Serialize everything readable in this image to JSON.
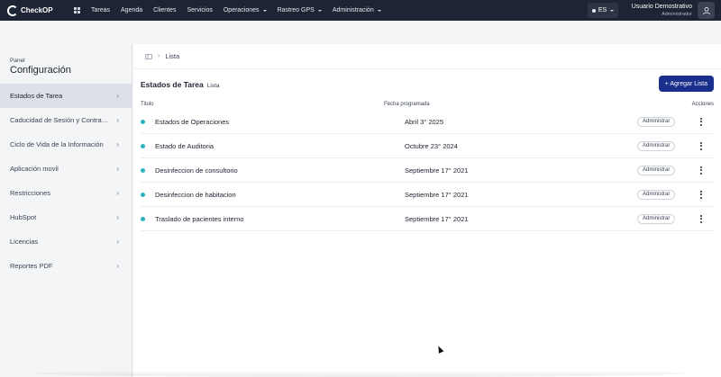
{
  "topbar": {
    "brand": "CheckOP",
    "nav": [
      {
        "label": "Tareas",
        "caret": false
      },
      {
        "label": "Agenda",
        "caret": false
      },
      {
        "label": "Clientes",
        "caret": false
      },
      {
        "label": "Servicios",
        "caret": false
      },
      {
        "label": "Operaciones",
        "caret": true
      },
      {
        "label": "Rastreo GPS",
        "caret": true
      },
      {
        "label": "Administración",
        "caret": true
      }
    ],
    "language": "ES",
    "user_name": "Usuario Demostrativo",
    "user_role": "Administrador"
  },
  "sidebar": {
    "small_title": "Panel",
    "big_title": "Configuración",
    "items": [
      {
        "label": "Estados de Tarea",
        "active": true
      },
      {
        "label": "Caducidad de Sesión y Contra…",
        "active": false
      },
      {
        "label": "Ciclo de Vida de la Información",
        "active": false
      },
      {
        "label": "Aplicación movil",
        "active": false
      },
      {
        "label": "Restricciones",
        "active": false
      },
      {
        "label": "HubSpot",
        "active": false
      },
      {
        "label": "Licencias",
        "active": false
      },
      {
        "label": "Reportes PDF",
        "active": false
      }
    ]
  },
  "main": {
    "breadcrumb": "Lista",
    "title": "Estados de Tarea",
    "subtitle": "Lista",
    "add_button": "+ Agregar Lista",
    "columns": {
      "title": "Titulo",
      "date": "Fecha programada",
      "actions": "Acciones"
    },
    "rows": [
      {
        "title": "Estados de Operaciones",
        "date": "Abril 3° 2025",
        "badge": "Administrar"
      },
      {
        "title": "Estado de Auditoria",
        "date": "Octubre 23° 2024",
        "badge": "Administrar"
      },
      {
        "title": "Desinfeccion de consultorio",
        "date": "Septiembre 17° 2021",
        "badge": "Administrar"
      },
      {
        "title": "Desinfeccion de habitacion",
        "date": "Septiembre 17° 2021",
        "badge": "Administrar"
      },
      {
        "title": "Traslado de pacientes interno",
        "date": "Septiembre 17° 2021",
        "badge": "Administrar"
      }
    ]
  },
  "colors": {
    "navbar": "#1d2433",
    "accent": "#1a2e8c",
    "status_dot": "#2bb3c0"
  }
}
